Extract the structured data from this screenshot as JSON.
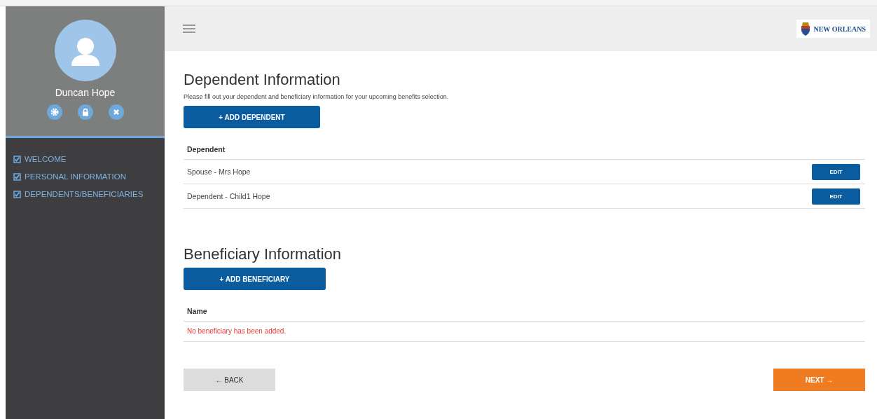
{
  "sidebar": {
    "user_name": "Duncan Hope",
    "nav_items": [
      {
        "label": "WELCOME",
        "checked": true
      },
      {
        "label": "PERSONAL INFORMATION",
        "checked": true
      },
      {
        "label": "DEPENDENTS/BENEFICIARIES",
        "checked": true
      }
    ]
  },
  "header": {
    "logo_text": "NEW ORLEANS"
  },
  "dependents": {
    "title": "Dependent Information",
    "intro": "Please fill out your dependent and beneficiary information for your upcoming benefits selection.",
    "add_button": "+ ADD DEPENDENT",
    "column": "Dependent",
    "rows": [
      {
        "name": "Spouse - Mrs Hope",
        "action": "EDIT"
      },
      {
        "name": "Dependent - Child1 Hope",
        "action": "EDIT"
      }
    ]
  },
  "beneficiaries": {
    "title": "Beneficiary Information",
    "add_button": "+ ADD BENEFICIARY",
    "column": "Name",
    "empty_message": "No beneficiary has been added."
  },
  "footer": {
    "back": "← BACK",
    "next": "NEXT →"
  }
}
